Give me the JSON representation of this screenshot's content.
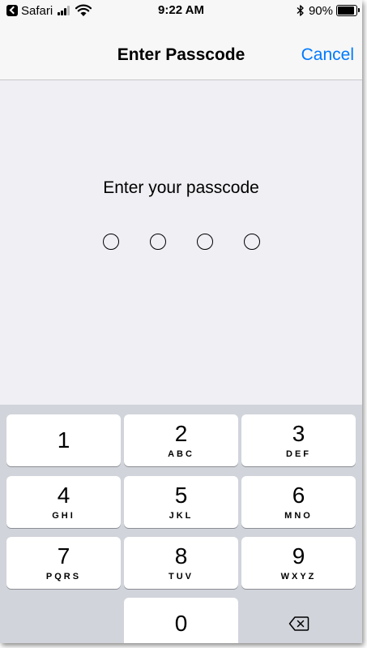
{
  "status_bar": {
    "back_app": "Safari",
    "time": "9:22 AM",
    "battery_percent": "90%",
    "battery_level": 0.9,
    "icons": [
      "back-icon",
      "signal-icon",
      "wifi-icon",
      "bluetooth-icon",
      "battery-icon"
    ]
  },
  "nav": {
    "title": "Enter Passcode",
    "cancel_label": "Cancel",
    "accent_color": "#007aff"
  },
  "prompt": {
    "text": "Enter your passcode",
    "digits_entered": 0,
    "digits_total": 4
  },
  "keypad": {
    "keys": [
      {
        "digit": "1",
        "letters": ""
      },
      {
        "digit": "2",
        "letters": "ABC"
      },
      {
        "digit": "3",
        "letters": "DEF"
      },
      {
        "digit": "4",
        "letters": "GHI"
      },
      {
        "digit": "5",
        "letters": "JKL"
      },
      {
        "digit": "6",
        "letters": "MNO"
      },
      {
        "digit": "7",
        "letters": "PQRS"
      },
      {
        "digit": "8",
        "letters": "TUV"
      },
      {
        "digit": "9",
        "letters": "WXYZ"
      },
      {
        "digit": "0",
        "letters": ""
      }
    ],
    "delete_icon": "backspace-icon"
  }
}
